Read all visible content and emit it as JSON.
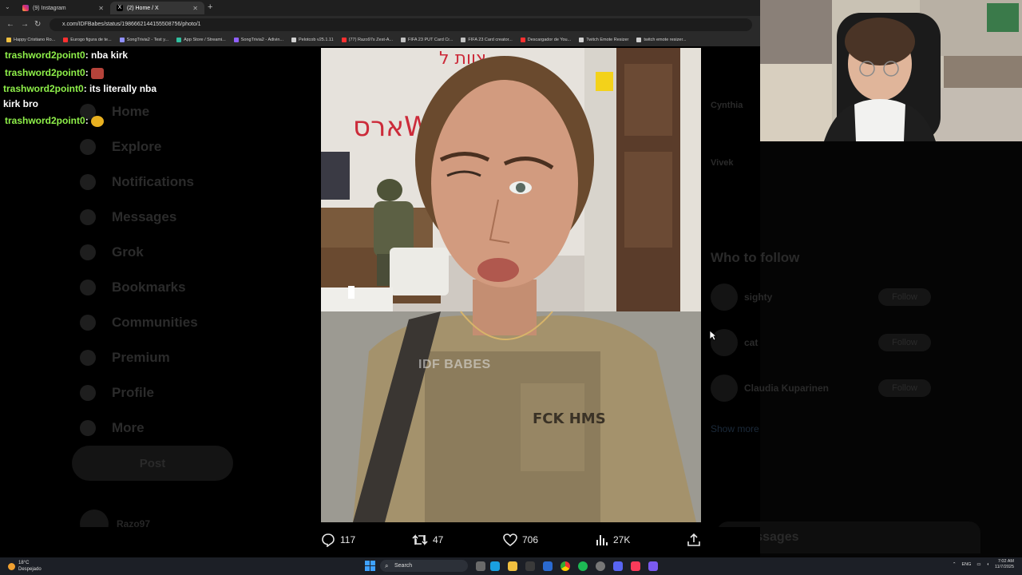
{
  "browser": {
    "tabs": [
      {
        "label": "(9) Instagram",
        "color": "#e1306c"
      },
      {
        "label": "(2) Home / X",
        "color": "#ffffff"
      }
    ],
    "url": "x.com/IDFBabes/status/1986662144155508756/photo/1",
    "bookmarks": [
      {
        "label": "Happy Cristiano Ro...",
        "color": "#f0c040"
      },
      {
        "label": "Eurogo figura de te...",
        "color": "#ff3030"
      },
      {
        "label": "SongTrivia2 - Test y...",
        "color": "#9090ff"
      },
      {
        "label": "App Store / Streami...",
        "color": "#30c0a0"
      },
      {
        "label": "SongTrivia2 - Adivin...",
        "color": "#9060ff"
      },
      {
        "label": "Pelotcob v25.1.11",
        "color": "#d0d0d0"
      },
      {
        "label": "(77) Razo97s Zest-A...",
        "color": "#ff3030"
      },
      {
        "label": "FIFA 23 PUT Card Cr...",
        "color": "#c0c0c0"
      },
      {
        "label": "FIFA 23 Card creator...",
        "color": "#c0c0c0"
      },
      {
        "label": "Descargador de You...",
        "color": "#ff3030"
      },
      {
        "label": "Twitch Emote Resizer",
        "color": "#d0d0d0"
      },
      {
        "label": "twitch emote resizer...",
        "color": "#d0d0d0"
      }
    ]
  },
  "x_background": {
    "nav": [
      "Home",
      "Explore",
      "Notifications",
      "Messages",
      "Grok",
      "Bookmarks",
      "Communities",
      "Premium",
      "Profile",
      "More"
    ],
    "post_label": "Post",
    "profile_name": "Razo97",
    "side_names": [
      "Cynthia",
      "Vivek"
    ],
    "who_to_follow": "Who to follow",
    "suggestions": [
      {
        "name": "sighty"
      },
      {
        "name": "cat"
      },
      {
        "name": "Claudia Kuparinen"
      }
    ],
    "follow_label": "Follow",
    "show_more": "Show more",
    "messages": "Messages"
  },
  "chat": [
    {
      "user": "trashword2point0",
      "text": ": nba kirk"
    },
    {
      "user": "trashword2point0",
      "text": ": ",
      "emote": "#b5433a"
    },
    {
      "user": "trashword2point0",
      "text": ": its literally nba kirk bro"
    },
    {
      "user": "trashword2point0",
      "text": ": ",
      "emote": "#e8b020"
    }
  ],
  "photo": {
    "watermark": "IDF BABES",
    "vest_patch": "FCK HMS",
    "wall_text": "ארסW",
    "wall_text2": "צוות ל"
  },
  "tweet_actions": {
    "replies": "117",
    "reposts": "47",
    "likes": "706",
    "views": "27K"
  },
  "taskbar": {
    "weather_temp": "18°C",
    "weather_desc": "Despejado",
    "search": "Search",
    "lang": "ENG",
    "time": "7:02 AM",
    "date": "11/7/2025"
  },
  "colors": {
    "username": "#8ff04a",
    "accent": "#1d9bf0"
  }
}
